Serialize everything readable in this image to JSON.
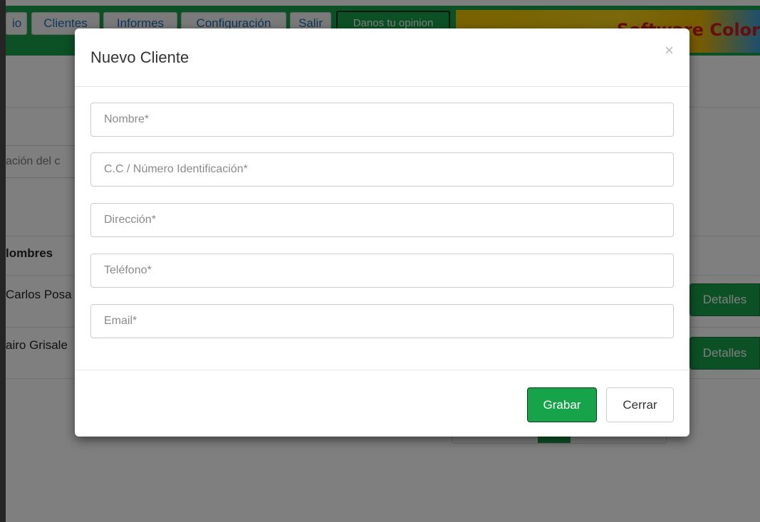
{
  "nav": {
    "items": [
      {
        "label": "io"
      },
      {
        "label": "Clientes"
      },
      {
        "label": "Informes"
      },
      {
        "label": "Configuración"
      },
      {
        "label": "Salir"
      }
    ],
    "opinion_label": "Danos tu opinion",
    "banner_text": "Software Color"
  },
  "background": {
    "search_placeholder": "ación del c",
    "table_header": "lombres",
    "rows": [
      {
        "name": "Carlos Posa",
        "action": "Detalles"
      },
      {
        "name": "airo Grisale",
        "action": "Detalles"
      }
    ]
  },
  "modal": {
    "title": "Nuevo Cliente",
    "close_symbol": "×",
    "fields": [
      {
        "placeholder": "Nombre*",
        "value": ""
      },
      {
        "placeholder": "C.C / Número Identificación*",
        "value": ""
      },
      {
        "placeholder": "Dirección*",
        "value": ""
      },
      {
        "placeholder": "Teléfono*",
        "value": ""
      },
      {
        "placeholder": "Email*",
        "value": ""
      }
    ],
    "save_label": "Grabar",
    "close_label": "Cerrar"
  },
  "colors": {
    "brand_green": "#16a34a",
    "link_blue": "#1c6fb5",
    "banner_red": "#d11b1b"
  }
}
